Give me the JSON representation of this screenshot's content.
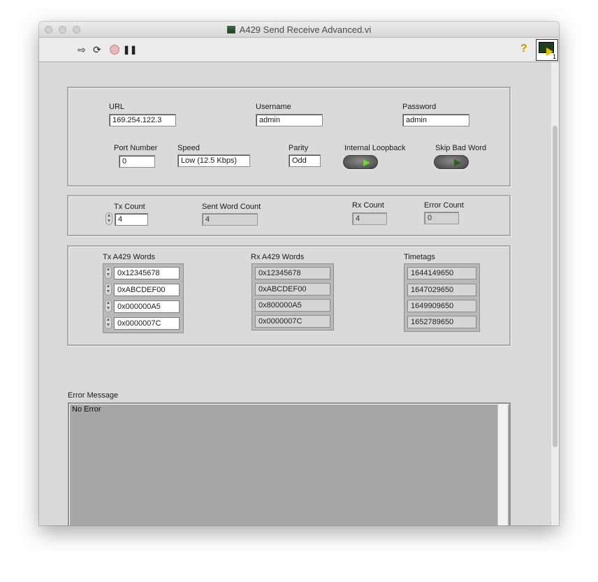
{
  "window": {
    "title": "A429 Send Receive Advanced.vi"
  },
  "toolbar": {
    "run_icon": "run-arrow-icon",
    "run_continuous_icon": "run-continuously-icon",
    "abort_icon": "abort-icon",
    "pause_icon": "pause-icon",
    "help_label": "?",
    "vi_icon_number": "1"
  },
  "connection": {
    "url_label": "URL",
    "url_value": "169.254.122.3",
    "username_label": "Username",
    "username_value": "admin",
    "password_label": "Password",
    "password_value": "admin",
    "port_label": "Port Number",
    "port_value": "0",
    "speed_label": "Speed",
    "speed_value": "Low (12.5 Kbps)",
    "parity_label": "Parity",
    "parity_value": "Odd",
    "loopback_label": "Internal Loopback",
    "loopback_on": true,
    "skip_label": "Skip Bad Word",
    "skip_on": false
  },
  "counts": {
    "tx_label": "Tx Count",
    "tx_value": "4",
    "sent_label": "Sent Word Count",
    "sent_value": "4",
    "rx_label": "Rx Count",
    "rx_value": "4",
    "error_label": "Error Count",
    "error_value": "0"
  },
  "words": {
    "tx_label": "Tx A429 Words",
    "tx": [
      "0x12345678",
      "0xABCDEF00",
      "0x000000A5",
      "0x0000007C"
    ],
    "rx_label": "Rx A429 Words",
    "rx": [
      "0x12345678",
      "0xABCDEF00",
      "0x800000A5",
      "0x0000007C"
    ],
    "timetags_label": "Timetags",
    "timetags": [
      "1644149650",
      "1647029650",
      "1649909650",
      "1652789650"
    ]
  },
  "error": {
    "label": "Error Message",
    "text": "No Error"
  },
  "colors": {
    "led_on": "#6cd43f",
    "led_off": "#2e5e22",
    "panel_bg": "#d9d9d9"
  }
}
